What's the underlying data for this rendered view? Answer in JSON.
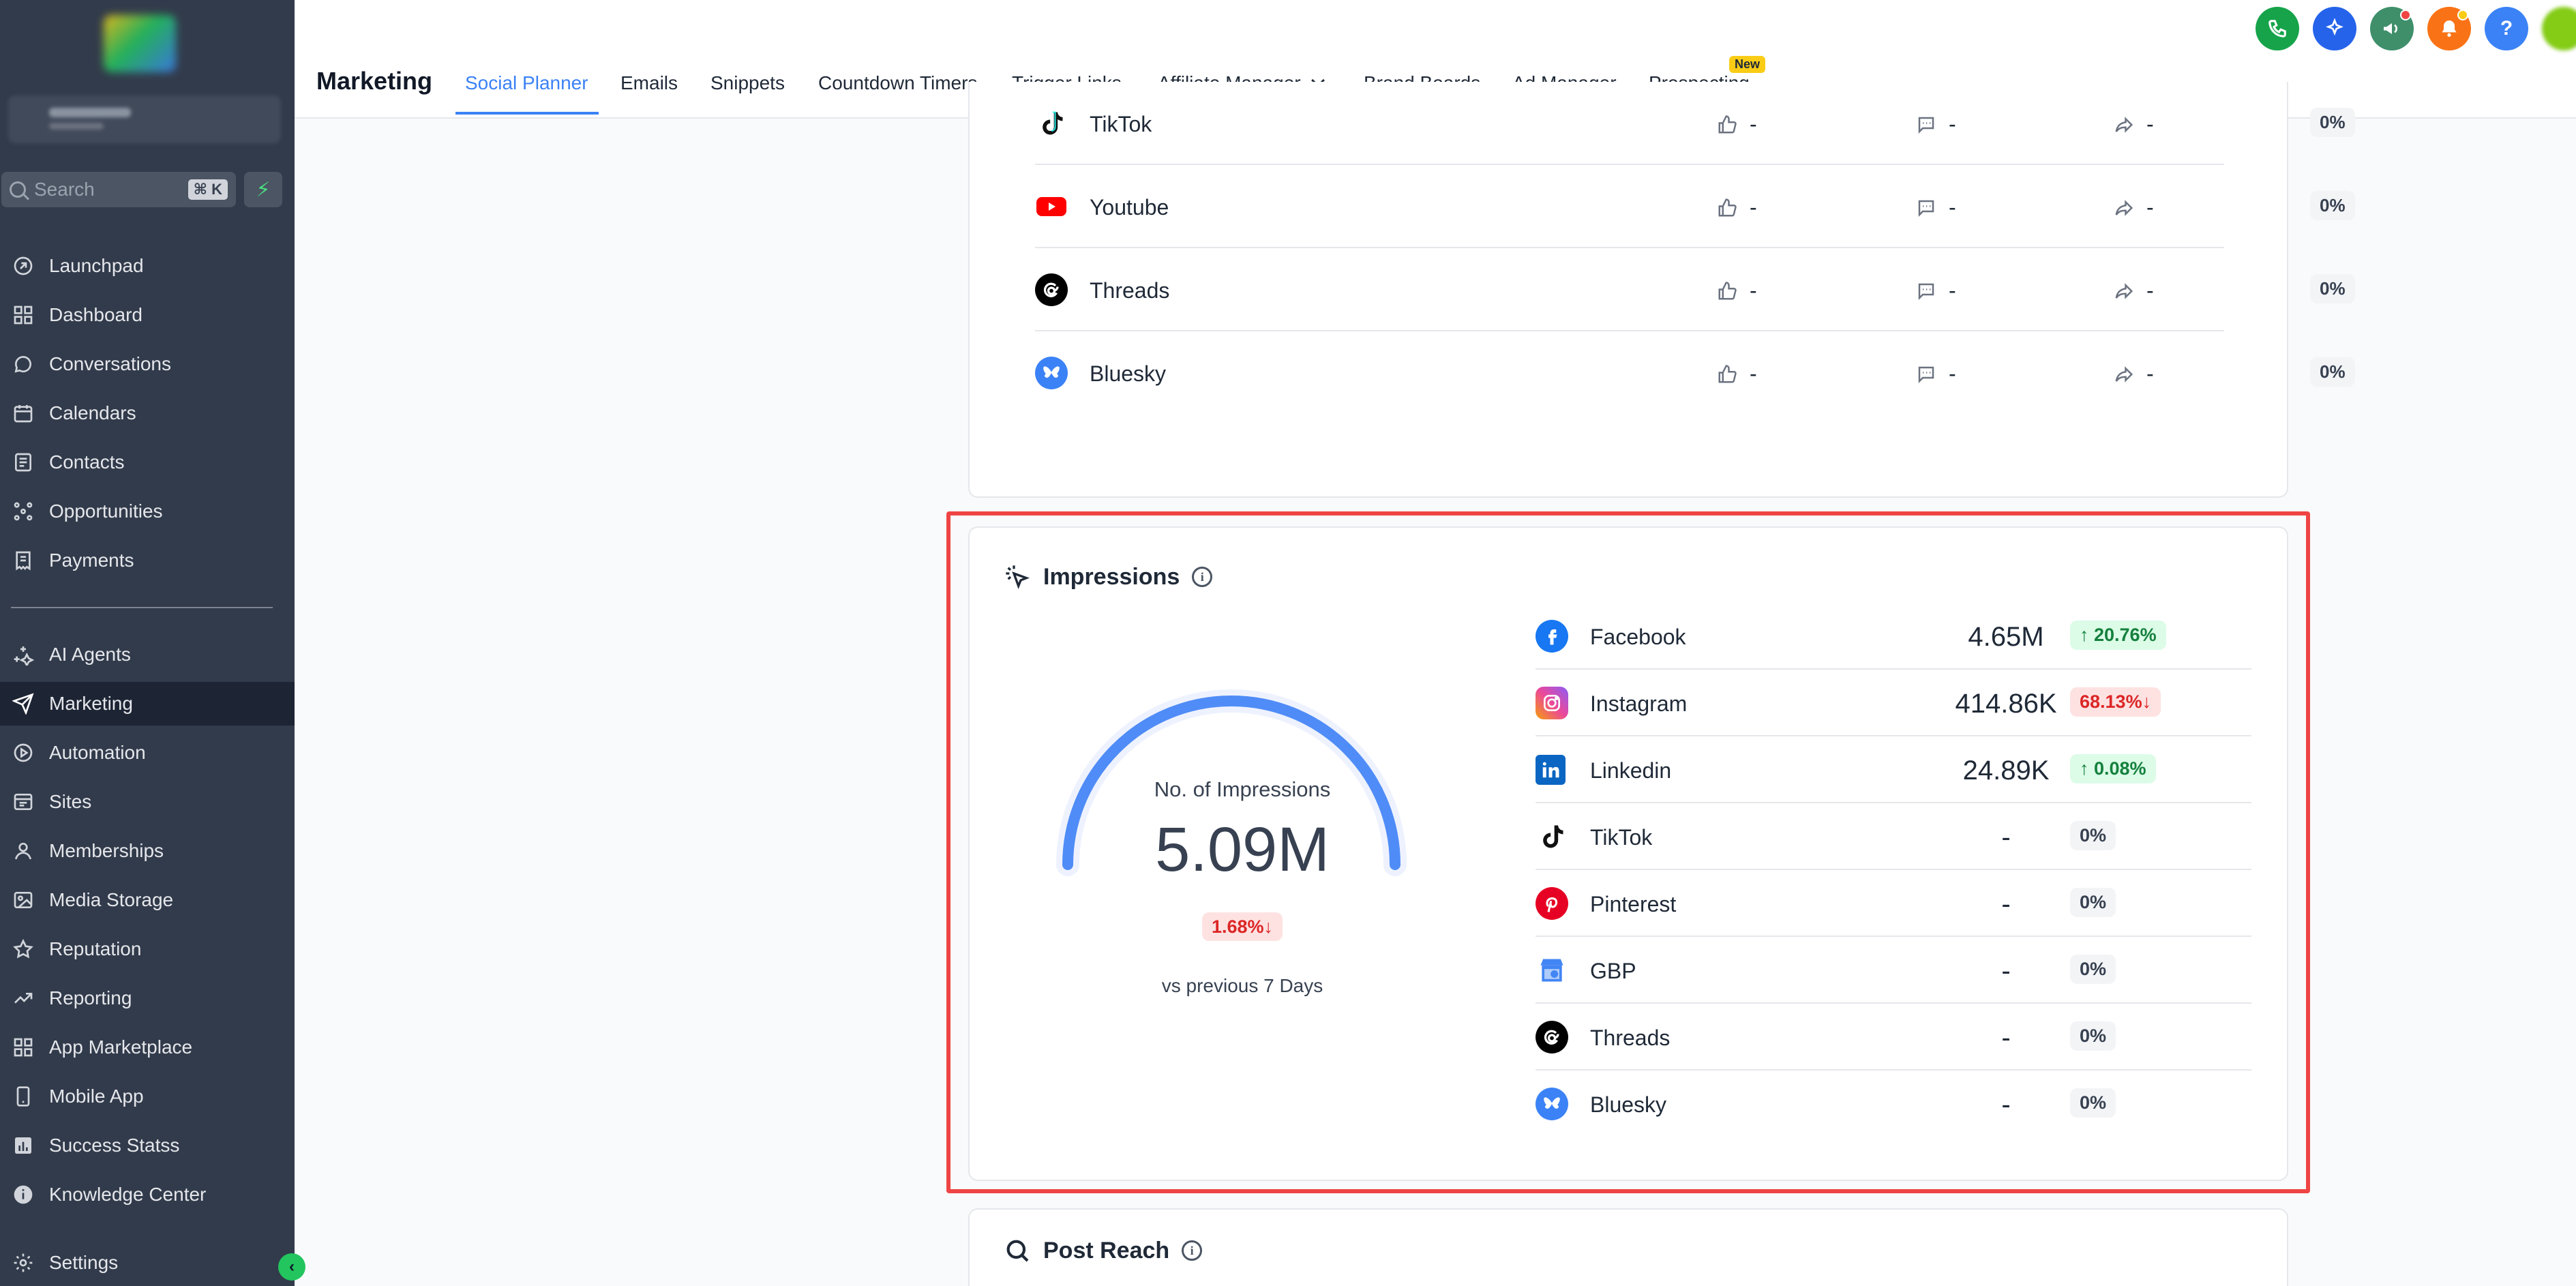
{
  "sidebar": {
    "search_placeholder": "Search",
    "search_shortcut": "⌘ K",
    "items": [
      {
        "label": "Launchpad",
        "icon": "rocket-icon"
      },
      {
        "label": "Dashboard",
        "icon": "grid-icon"
      },
      {
        "label": "Conversations",
        "icon": "chat-icon"
      },
      {
        "label": "Calendars",
        "icon": "calendar-icon"
      },
      {
        "label": "Contacts",
        "icon": "contacts-icon"
      },
      {
        "label": "Opportunities",
        "icon": "network-icon"
      },
      {
        "label": "Payments",
        "icon": "receipt-icon"
      },
      {
        "label": "AI Agents",
        "icon": "sparkle-icon"
      },
      {
        "label": "Marketing",
        "icon": "send-icon"
      },
      {
        "label": "Automation",
        "icon": "automation-icon"
      },
      {
        "label": "Sites",
        "icon": "sites-icon"
      },
      {
        "label": "Memberships",
        "icon": "graduation-icon"
      },
      {
        "label": "Media Storage",
        "icon": "image-icon"
      },
      {
        "label": "Reputation",
        "icon": "star-icon"
      },
      {
        "label": "Reporting",
        "icon": "trend-icon"
      },
      {
        "label": "App Marketplace",
        "icon": "apps-icon"
      },
      {
        "label": "Mobile App",
        "icon": "phone-icon"
      },
      {
        "label": "Success Statss",
        "icon": "chart-icon"
      },
      {
        "label": "Knowledge Center",
        "icon": "info-icon"
      },
      {
        "label": "Settings",
        "icon": "gear-icon"
      }
    ]
  },
  "topbar": {
    "title": "Marketing",
    "tabs": [
      {
        "label": "Social Planner"
      },
      {
        "label": "Emails"
      },
      {
        "label": "Snippets"
      },
      {
        "label": "Countdown Timers"
      },
      {
        "label": "Trigger Links"
      },
      {
        "label": "Affiliate Manager"
      },
      {
        "label": "Brand Boards"
      },
      {
        "label": "Ad Manager"
      },
      {
        "label": "Prospecting"
      }
    ],
    "new_badge": "New",
    "help_label": "?"
  },
  "engagement": {
    "rows": [
      {
        "name": "TikTok",
        "likes": "-",
        "comments": "-",
        "shares": "-",
        "rate": "0%"
      },
      {
        "name": "Youtube",
        "likes": "-",
        "comments": "-",
        "shares": "-",
        "rate": "0%"
      },
      {
        "name": "Threads",
        "likes": "-",
        "comments": "-",
        "shares": "-",
        "rate": "0%"
      },
      {
        "name": "Bluesky",
        "likes": "-",
        "comments": "-",
        "shares": "-",
        "rate": "0%"
      }
    ]
  },
  "impressions": {
    "title": "Impressions",
    "gauge_label": "No. of Impressions",
    "total": "5.09M",
    "change": "1.68%↓",
    "period": "vs previous 7 Days",
    "rows": [
      {
        "name": "Facebook",
        "value": "4.65M",
        "change": "↑ 20.76%",
        "trend": "up"
      },
      {
        "name": "Instagram",
        "value": "414.86K",
        "change": "68.13%↓",
        "trend": "down"
      },
      {
        "name": "Linkedin",
        "value": "24.89K",
        "change": "↑ 0.08%",
        "trend": "up"
      },
      {
        "name": "TikTok",
        "value": "-",
        "change": "0%",
        "trend": "zero"
      },
      {
        "name": "Pinterest",
        "value": "-",
        "change": "0%",
        "trend": "zero"
      },
      {
        "name": "GBP",
        "value": "-",
        "change": "0%",
        "trend": "zero"
      },
      {
        "name": "Threads",
        "value": "-",
        "change": "0%",
        "trend": "zero"
      },
      {
        "name": "Bluesky",
        "value": "-",
        "change": "0%",
        "trend": "zero"
      }
    ]
  },
  "post_reach": {
    "title": "Post Reach"
  },
  "colors": {
    "sidebar_bg": "#323b4b",
    "accent": "#3b82f6",
    "highlight_border": "#ef4444",
    "up": "#15803d",
    "down": "#dc2626"
  }
}
